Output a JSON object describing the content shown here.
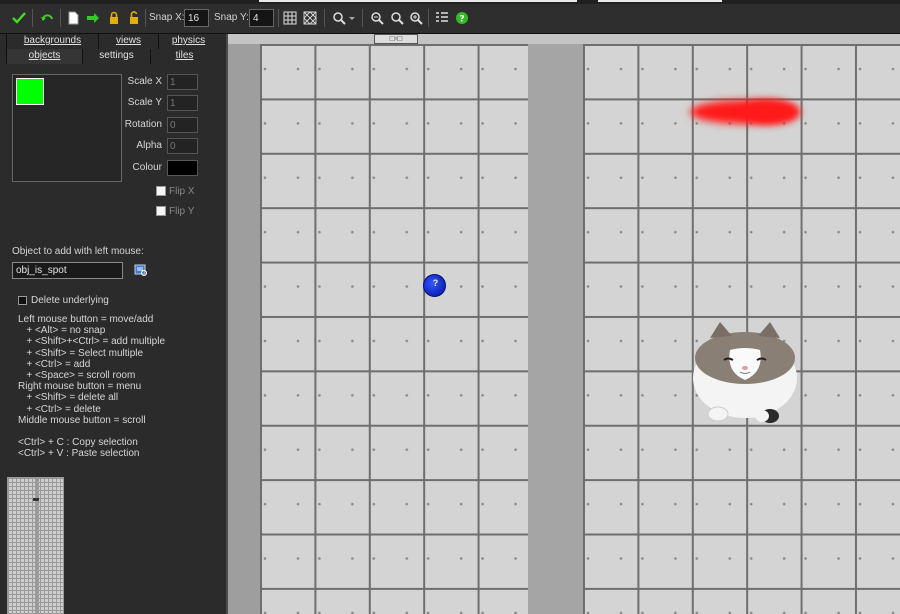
{
  "toolbar": {
    "snap_x_label": "Snap X:",
    "snap_x_value": "16",
    "snap_y_label": "Snap Y:",
    "snap_y_value": "4",
    "icons": [
      "check-icon",
      "undo-icon",
      "new-document-icon",
      "arrow-right-icon",
      "lock-icon",
      "unlock-icon",
      "grid-icon",
      "isometric-grid-icon",
      "zoom-icon",
      "zoom-out-icon",
      "zoom-reset-icon",
      "zoom-in-icon",
      "list-icon",
      "help-icon"
    ]
  },
  "tabs": {
    "row1": [
      "backgrounds",
      "views",
      "physics"
    ],
    "row2": [
      "objects",
      "settings",
      "tiles"
    ],
    "selected": "objects"
  },
  "properties": {
    "scale_x_label": "Scale X",
    "scale_x_value": "1",
    "scale_y_label": "Scale Y",
    "scale_y_value": "1",
    "rotation_label": "Rotation",
    "rotation_value": "0",
    "alpha_label": "Alpha",
    "alpha_value": "0",
    "colour_label": "Colour",
    "colour_value": "#000000",
    "flip_x_label": "Flip X",
    "flip_y_label": "Flip Y",
    "preview_color": "#00ff00"
  },
  "object": {
    "label": "Object to add with left mouse:",
    "value": "obj_is_spot"
  },
  "delete_underlying_label": "Delete underlying",
  "help_lines": [
    "Left mouse button = move/add",
    "   + <Alt> = no snap",
    "   + <Shift>+<Ctrl> = add multiple",
    "   + <Shift> = Select multiple",
    "   + <Ctrl> = add",
    "   + <Space> = scroll room",
    "Right mouse button = menu",
    "   + <Shift> = delete all",
    "   + <Ctrl> = delete",
    "Middle mouse button = scroll",
    "",
    "<Ctrl> + C : Copy selection",
    "<Ctrl> + V : Paste selection"
  ],
  "room": {
    "spot_label": "?",
    "marker_label": "□▫□"
  }
}
